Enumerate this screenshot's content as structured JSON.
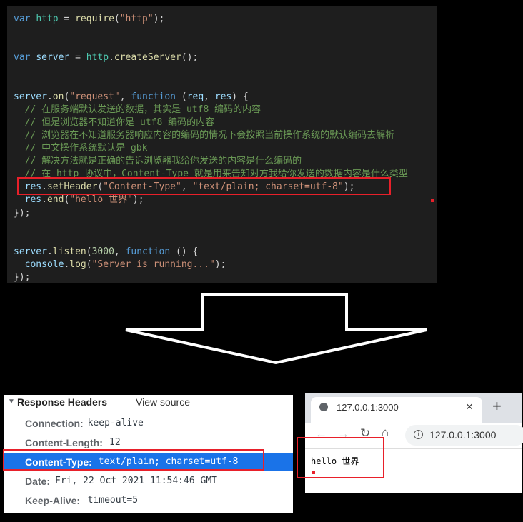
{
  "code": {
    "lines": [
      [
        [
          "kw",
          "var "
        ],
        [
          "ns",
          "http"
        ],
        [
          "p",
          " = "
        ],
        [
          "fn",
          "require"
        ],
        [
          "p",
          "("
        ],
        [
          "str",
          "\"http\""
        ],
        [
          "p",
          ");"
        ]
      ],
      [],
      [],
      [
        [
          "kw",
          "var "
        ],
        [
          "var",
          "server"
        ],
        [
          "p",
          " = "
        ],
        [
          "ns",
          "http"
        ],
        [
          "p",
          "."
        ],
        [
          "fn",
          "createServer"
        ],
        [
          "p",
          "();"
        ]
      ],
      [],
      [],
      [
        [
          "var",
          "server"
        ],
        [
          "p",
          "."
        ],
        [
          "fn",
          "on"
        ],
        [
          "p",
          "("
        ],
        [
          "str",
          "\"request\""
        ],
        [
          "p",
          ", "
        ],
        [
          "kw",
          "function"
        ],
        [
          "p",
          " ("
        ],
        [
          "var",
          "req"
        ],
        [
          "p",
          ", "
        ],
        [
          "var",
          "res"
        ],
        [
          "p",
          ") {"
        ]
      ],
      [
        [
          "cm",
          "  // 在服务端默认发送的数据，其实是 utf8 编码的内容"
        ]
      ],
      [
        [
          "cm",
          "  // 但是浏览器不知道你是 utf8 编码的内容"
        ]
      ],
      [
        [
          "cm",
          "  // 浏览器在不知道服务器响应内容的编码的情况下会按照当前操作系统的默认编码去解析"
        ]
      ],
      [
        [
          "cm",
          "  // 中文操作系统默认是 gbk"
        ]
      ],
      [
        [
          "cm",
          "  // 解决方法就是正确的告诉浏览器我给你发送的内容是什么编码的"
        ]
      ],
      [
        [
          "cm",
          "  // 在 http 协议中，Content-Type 就是用来告知对方我给你发送的数据内容是什么类型"
        ]
      ],
      [
        [
          "p",
          "  "
        ],
        [
          "var",
          "res"
        ],
        [
          "p",
          "."
        ],
        [
          "fn",
          "setHeader"
        ],
        [
          "p",
          "("
        ],
        [
          "str",
          "\"Content-Type\""
        ],
        [
          "p",
          ", "
        ],
        [
          "str",
          "\"text/plain; charset=utf-8\""
        ],
        [
          "p",
          ");"
        ]
      ],
      [
        [
          "p",
          "  "
        ],
        [
          "var",
          "res"
        ],
        [
          "p",
          "."
        ],
        [
          "fn",
          "end"
        ],
        [
          "p",
          "("
        ],
        [
          "str",
          "\"hello 世界\""
        ],
        [
          "p",
          ");"
        ]
      ],
      [
        [
          "p",
          "});"
        ]
      ],
      [],
      [],
      [
        [
          "var",
          "server"
        ],
        [
          "p",
          "."
        ],
        [
          "fn",
          "listen"
        ],
        [
          "p",
          "("
        ],
        [
          "num",
          "3000"
        ],
        [
          "p",
          ", "
        ],
        [
          "kw",
          "function"
        ],
        [
          "p",
          " () {"
        ]
      ],
      [
        [
          "p",
          "  "
        ],
        [
          "var",
          "console"
        ],
        [
          "p",
          "."
        ],
        [
          "fn",
          "log"
        ],
        [
          "p",
          "("
        ],
        [
          "str",
          "\"Server is running...\""
        ],
        [
          "p",
          ");"
        ]
      ],
      [
        [
          "p",
          "});"
        ]
      ]
    ]
  },
  "devtools": {
    "section_title": "Response Headers",
    "view_source": "View source",
    "headers": [
      {
        "key": "Connection:",
        "value": "keep-alive"
      },
      {
        "key": "Content-Length:",
        "value": "12"
      },
      {
        "key": "Content-Type:",
        "value": "text/plain; charset=utf-8",
        "selected": true
      },
      {
        "key": "Date:",
        "value": "Fri, 22 Oct 2021 11:54:46 GMT"
      },
      {
        "key": "Keep-Alive:",
        "value": "timeout=5"
      }
    ]
  },
  "browser": {
    "tab_title": "127.0.0.1:3000",
    "close": "×",
    "new_tab": "+",
    "url": "127.0.0.1:3000",
    "body_text": "hello 世界"
  },
  "colors": {
    "highlight": "#e8202a",
    "selected_row": "#1a73e8",
    "editor_bg": "#1e1e1e"
  }
}
